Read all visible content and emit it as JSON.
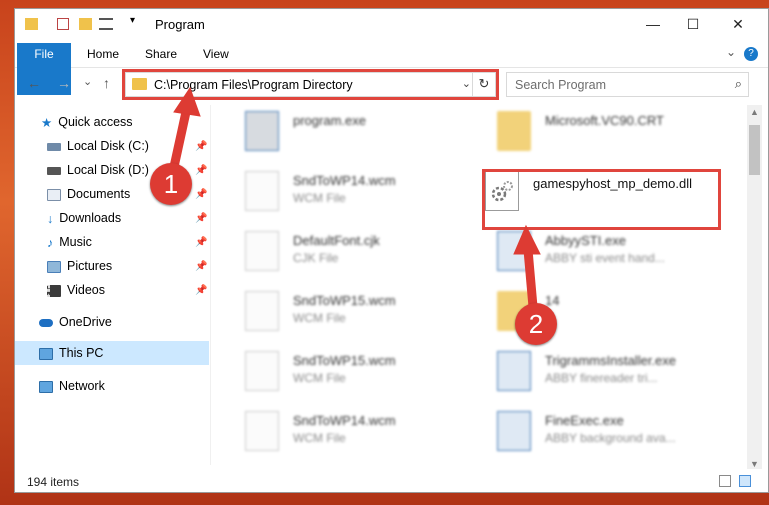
{
  "window": {
    "title": "Program",
    "min_glyph": "—",
    "max_glyph": "☐",
    "close_glyph": "✕"
  },
  "ribbon": {
    "tabs": [
      "File",
      "Home",
      "Share",
      "View"
    ],
    "help_glyph": "?",
    "expand_glyph": "⌄"
  },
  "nav": {
    "back_glyph": "←",
    "forward_glyph": "→",
    "recent_glyph": "⌄",
    "up_glyph": "↑"
  },
  "address": {
    "path": "C:\\Program Files\\Program Directory",
    "dropdown_glyph": "⌄",
    "refresh_glyph": "↻"
  },
  "search": {
    "placeholder": "Search Program",
    "icon_glyph": "⌕"
  },
  "sidebar": {
    "quick_access": "Quick access",
    "items": [
      {
        "label": "Local Disk (C:)",
        "pinned": true
      },
      {
        "label": "Local Disk (D:)",
        "pinned": true
      },
      {
        "label": "Documents",
        "pinned": true
      },
      {
        "label": "Downloads",
        "pinned": true
      },
      {
        "label": "Music",
        "pinned": true
      },
      {
        "label": "Pictures",
        "pinned": true
      },
      {
        "label": "Videos",
        "pinned": true
      }
    ],
    "onedrive": "OneDrive",
    "this_pc": "This PC",
    "network": "Network",
    "pin_glyph": "📌"
  },
  "files": {
    "left": [
      {
        "name": "program.exe",
        "type": ""
      },
      {
        "name": "SndToWP14.wcm",
        "type": "WCM File"
      },
      {
        "name": "DefaultFont.cjk",
        "type": "CJK File"
      },
      {
        "name": "SndToWP15.wcm",
        "type": "WCM File"
      },
      {
        "name": "SndToWP15.wcm",
        "type": "WCM File"
      },
      {
        "name": "SndToWP14.wcm",
        "type": "WCM File"
      }
    ],
    "right": [
      {
        "name": "Microsoft.VC90.CRT",
        "type": ""
      },
      {
        "name": "gamespyhost_mp_demo.dll",
        "type": ""
      },
      {
        "name": "AbbyySTI.exe",
        "type": "ABBY sti event hand..."
      },
      {
        "name": "14",
        "type": ""
      },
      {
        "name": "TrigrammsInstaller.exe",
        "type": "ABBY finereader tri..."
      },
      {
        "name": "FineExec.exe",
        "type": "ABBY background ava..."
      }
    ]
  },
  "status": {
    "item_count": "194 items"
  },
  "annotations": {
    "step1": "1",
    "step2": "2",
    "color": "#dd3b33"
  }
}
